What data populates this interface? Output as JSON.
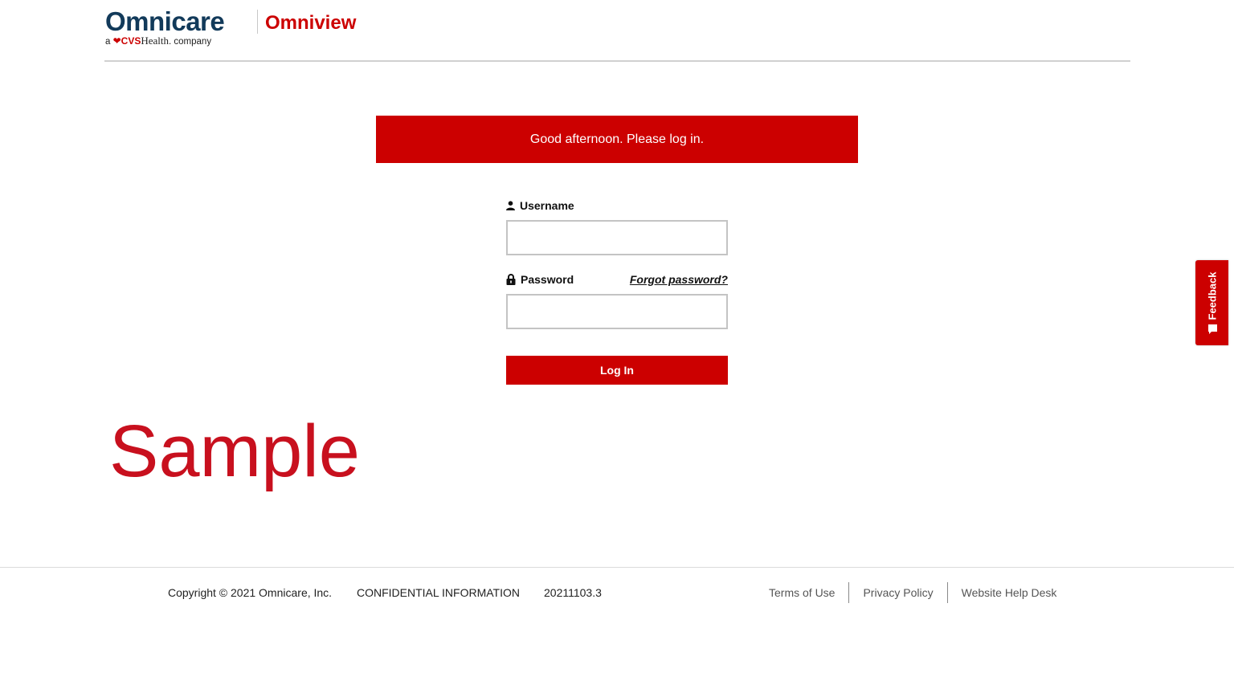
{
  "header": {
    "logo_name": "Omnicare",
    "logo_tagline_prefix": "a",
    "logo_tagline_brand": "CVS",
    "logo_tagline_health": "Health",
    "logo_tagline_suffix": ". company",
    "product_name": "Omniview"
  },
  "banner": {
    "greeting": "Good afternoon. Please log in."
  },
  "login_form": {
    "username_label": "Username",
    "username_value": "",
    "password_label": "Password",
    "password_value": "",
    "forgot_password_link": "Forgot password?",
    "submit_label": "Log In",
    "username_icon": "user-icon",
    "password_icon": "lock-icon"
  },
  "watermark": "Sample",
  "feedback_tab": {
    "label": "Feedback",
    "icon": "feedback-icon"
  },
  "footer": {
    "copyright": "Copyright © 2021 Omnicare, Inc.",
    "confidential": "CONFIDENTIAL INFORMATION",
    "version": "20211103.3",
    "links": [
      "Terms of Use",
      "Privacy Policy",
      "Website Help Desk"
    ]
  },
  "colors": {
    "brand_red": "#cc0000",
    "logo_navy": "#123a5a"
  }
}
